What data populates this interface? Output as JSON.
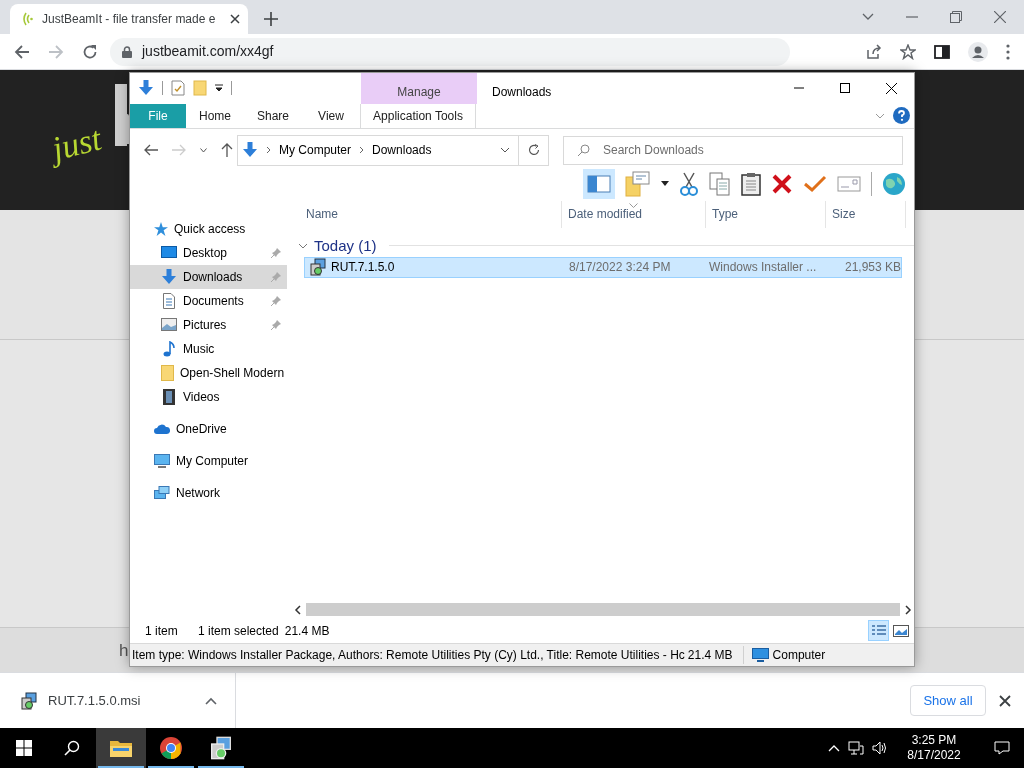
{
  "browser": {
    "tabs": [
      {
        "title": "JustBeamIt - file transfer made e",
        "selected": true
      }
    ],
    "url": "justbeamit.com/xx4gf"
  },
  "page": {
    "logo_text": "just",
    "footer_text": "h"
  },
  "explorer": {
    "title": "Downloads",
    "contextual_tab": "Manage",
    "ribbon_tabs": [
      {
        "label": "File",
        "kind": "file"
      },
      {
        "label": "Home",
        "kind": "plain"
      },
      {
        "label": "Share",
        "kind": "plain"
      },
      {
        "label": "View",
        "kind": "plain"
      },
      {
        "label": "Application Tools",
        "kind": "contextual"
      }
    ],
    "breadcrumbs": [
      "My Computer",
      "Downloads"
    ],
    "search": {
      "placeholder": "Search Downloads"
    },
    "columns": [
      "Name",
      "Date modified",
      "Type",
      "Size"
    ],
    "nav": [
      {
        "label": "Quick access",
        "selected": false,
        "children": [
          {
            "label": "Desktop",
            "pinned": true,
            "selected": false
          },
          {
            "label": "Downloads",
            "pinned": true,
            "selected": true
          },
          {
            "label": "Documents",
            "pinned": true,
            "selected": false
          },
          {
            "label": "Pictures",
            "pinned": true,
            "selected": false
          },
          {
            "label": "Music",
            "pinned": false,
            "selected": false
          },
          {
            "label": "Open-Shell Modern",
            "pinned": false,
            "selected": false
          },
          {
            "label": "Videos",
            "pinned": false,
            "selected": false
          }
        ]
      },
      {
        "label": "OneDrive",
        "selected": false
      },
      {
        "label": "My Computer",
        "selected": false
      },
      {
        "label": "Network",
        "selected": false
      }
    ],
    "groups": [
      {
        "label": "Today (1)",
        "expanded": true,
        "files": [
          {
            "name": "RUT.7.1.5.0",
            "date": "8/17/2022 3:24 PM",
            "type": "Windows Installer ...",
            "size": "21,953 KB",
            "selected": true
          }
        ]
      }
    ],
    "status": {
      "count": "1 item",
      "selection": "1 item selected",
      "selection_size": "21.4 MB"
    },
    "view_modes": [
      {
        "kind": "details",
        "selected": true
      },
      {
        "kind": "tiles",
        "selected": false
      }
    ],
    "details_bar": {
      "info": "Item type: Windows Installer Package, Authors: Remote Utilities Pty (Cy) Ltd., Title: Remote Utilities - Hc",
      "size": "21.4 MB",
      "location": "Computer"
    }
  },
  "downloads_bar": {
    "file": "RUT.7.1.5.0.msi",
    "show_all": "Show all"
  },
  "taskbar": {
    "apps": [
      {
        "kind": "explorer",
        "selected": true
      },
      {
        "kind": "browser",
        "selected": false
      },
      {
        "kind": "installer",
        "selected": false
      }
    ],
    "time": "3:25 PM",
    "date": "8/17/2022"
  }
}
